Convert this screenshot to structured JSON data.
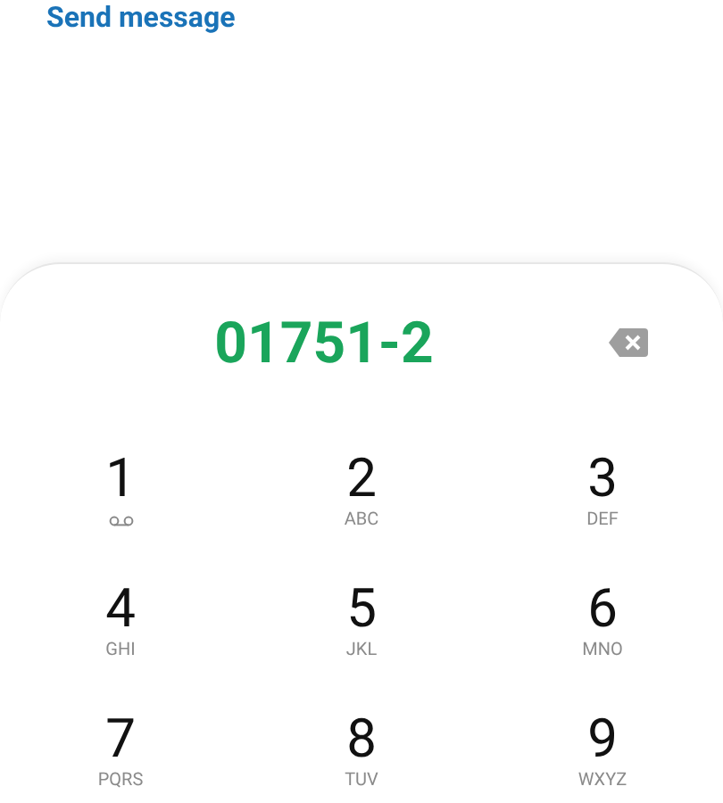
{
  "link": {
    "label": "Send message"
  },
  "dialer": {
    "number": "01751-2"
  },
  "keys": [
    {
      "digit": "1",
      "kind": "voicemail"
    },
    {
      "digit": "2",
      "kind": "letters",
      "letters": "ABC"
    },
    {
      "digit": "3",
      "kind": "letters",
      "letters": "DEF"
    },
    {
      "digit": "4",
      "kind": "letters",
      "letters": "GHI"
    },
    {
      "digit": "5",
      "kind": "letters",
      "letters": "JKL"
    },
    {
      "digit": "6",
      "kind": "letters",
      "letters": "MNO"
    },
    {
      "digit": "7",
      "kind": "letters",
      "letters": "PQRS"
    },
    {
      "digit": "8",
      "kind": "letters",
      "letters": "TUV"
    },
    {
      "digit": "9",
      "kind": "letters",
      "letters": "WXYZ"
    }
  ]
}
